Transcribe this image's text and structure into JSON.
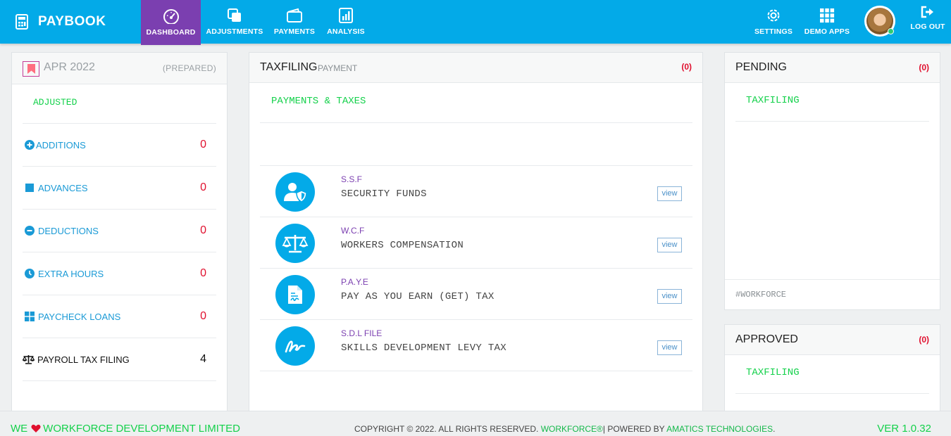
{
  "app": {
    "brand": "PAYBOOK"
  },
  "nav": {
    "dashboard": "DASHBOARD",
    "adjustments": "ADJUSTMENTS",
    "payments": "PAYMENTS",
    "analysis": "ANALYSIS",
    "settings": "SETTINGS",
    "demo_apps": "DEMO APPS",
    "logout": "LOG OUT"
  },
  "left": {
    "period": "APR 2022",
    "status": "(PREPARED)",
    "section": "ADJUSTED",
    "rows": [
      {
        "label": "ADDITIONS",
        "value": "0"
      },
      {
        "label": "ADVANCES",
        "value": "0"
      },
      {
        "label": "DEDUCTIONS",
        "value": "0"
      },
      {
        "label": "EXTRA HOURS",
        "value": "0"
      },
      {
        "label": "PAYCHECK LOANS",
        "value": "0"
      },
      {
        "label": "PAYROLL TAX FILING",
        "value": "4"
      }
    ]
  },
  "center": {
    "title": "TAXFILING",
    "subtitle": "PAYMENT",
    "count": "(0)",
    "section": "PAYMENTS & TAXES",
    "items": [
      {
        "abbr": "S.S.F",
        "name": "SECURITY FUNDS",
        "action": "view"
      },
      {
        "abbr": "W.C.F",
        "name": "WORKERS COMPENSATION",
        "action": "view"
      },
      {
        "abbr": "P.A.Y.E",
        "name": "PAY AS YOU EARN (GET) TAX",
        "action": "view"
      },
      {
        "abbr": "S.D.L FILE",
        "name": "SKILLS DEVELOPMENT LEVY TAX",
        "action": "view"
      }
    ]
  },
  "pending": {
    "title": "PENDING",
    "count": "(0)",
    "item": "TAXFILING",
    "footer": "#WORKFORCE"
  },
  "approved": {
    "title": "APPROVED",
    "count": "(0)",
    "item": "TAXFILING"
  },
  "footer": {
    "we": "WE",
    "company": "WORKFORCE DEVELOPMENT LIMITED",
    "copyright": "COPYRIGHT © 2022. ALL RIGHTS RESERVED.",
    "workforce": "WORKFORCE®",
    "powered": "| POWERED BY",
    "amatics": "AMATICS TECHNOLOGIES",
    "dot": ".",
    "version": "VER 1.0.32"
  },
  "colors": {
    "topbar": "#03aae8",
    "active_nav": "#7b3fb0",
    "accent_green": "#14d14b",
    "count_red": "#e0102e"
  }
}
